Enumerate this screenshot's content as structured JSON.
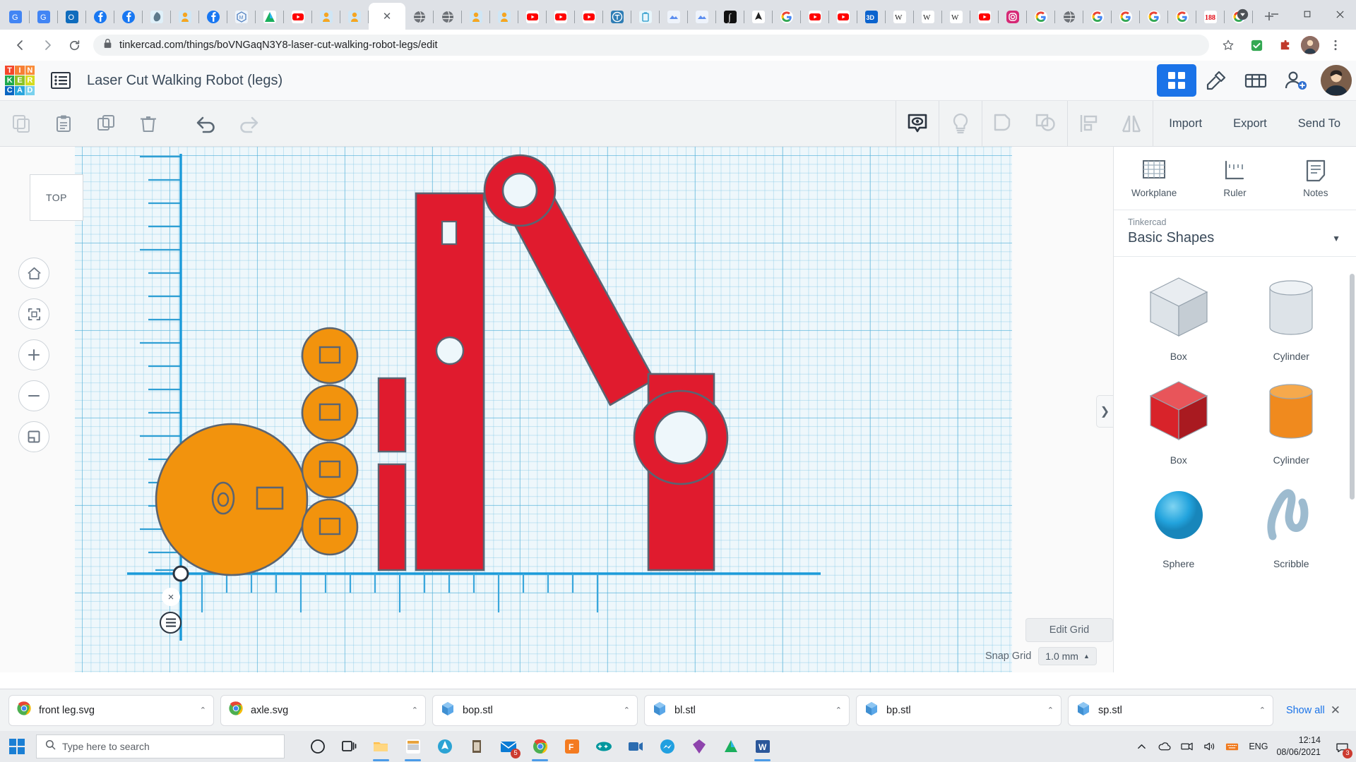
{
  "browser": {
    "url": "tinkercad.com/things/boVNGaqN3Y8-laser-cut-walking-robot-legs/edit",
    "lock_icon": "lock-icon",
    "back_icon": "back-arrow-icon",
    "forward_icon": "forward-arrow-icon",
    "reload_icon": "reload-icon",
    "star_icon": "bookmark-star-icon",
    "extension_icon": "extension-icon",
    "menu_icon": "chrome-menu-icon",
    "newtab_label": "+",
    "minimize_label": "—",
    "maximize_label": "❐",
    "close_label": "✕",
    "tabs": [
      {
        "name": "google-translate",
        "kind": "gtranslate",
        "active": false
      },
      {
        "name": "google-translate",
        "kind": "gtranslate",
        "active": false
      },
      {
        "name": "outlook",
        "kind": "outlook",
        "active": false
      },
      {
        "name": "facebook",
        "kind": "facebook",
        "active": false
      },
      {
        "name": "facebook",
        "kind": "facebook",
        "active": false
      },
      {
        "name": "tinkercad",
        "kind": "tinkercad-leaf",
        "active": false
      },
      {
        "name": "scratch",
        "kind": "scratch",
        "active": false
      },
      {
        "name": "facebook",
        "kind": "facebook",
        "active": false
      },
      {
        "name": "makers",
        "kind": "hexm",
        "active": false
      },
      {
        "name": "autodesk",
        "kind": "autodesk",
        "active": false
      },
      {
        "name": "youtube",
        "kind": "youtube",
        "active": false
      },
      {
        "name": "scratch",
        "kind": "scratch",
        "active": false
      },
      {
        "name": "scratch",
        "kind": "scratch",
        "active": false
      },
      {
        "name": "tinkercad-active",
        "kind": "active-tab",
        "active": true
      },
      {
        "name": "generic-page",
        "kind": "globe",
        "active": false
      },
      {
        "name": "generic-page",
        "kind": "globe",
        "active": false
      },
      {
        "name": "scratch",
        "kind": "scratch",
        "active": false
      },
      {
        "name": "scratch",
        "kind": "scratch",
        "active": false
      },
      {
        "name": "youtube",
        "kind": "youtube",
        "active": false
      },
      {
        "name": "youtube",
        "kind": "youtube",
        "active": false
      },
      {
        "name": "youtube",
        "kind": "youtube",
        "active": false
      },
      {
        "name": "thingiverse",
        "kind": "thingiverse",
        "active": false
      },
      {
        "name": "kidsdoc",
        "kind": "kidsdoc",
        "active": false
      },
      {
        "name": "slides",
        "kind": "slides",
        "active": false
      },
      {
        "name": "slides",
        "kind": "slides",
        "active": false
      },
      {
        "name": "integral",
        "kind": "integral",
        "active": false
      },
      {
        "name": "inkscape",
        "kind": "inkscape",
        "active": false
      },
      {
        "name": "google",
        "kind": "google",
        "active": false
      },
      {
        "name": "youtube",
        "kind": "youtube",
        "active": false
      },
      {
        "name": "youtube",
        "kind": "youtube",
        "active": false
      },
      {
        "name": "3d-viewer",
        "kind": "threed",
        "active": false
      },
      {
        "name": "wikipedia",
        "kind": "wikipedia",
        "active": false
      },
      {
        "name": "wikipedia",
        "kind": "wikipedia",
        "active": false
      },
      {
        "name": "wikipedia",
        "kind": "wikipedia",
        "active": false
      },
      {
        "name": "youtube",
        "kind": "youtube",
        "active": false
      },
      {
        "name": "instagram",
        "kind": "instagram",
        "active": false
      },
      {
        "name": "google",
        "kind": "google",
        "active": false
      },
      {
        "name": "generic-page",
        "kind": "globe",
        "active": false
      },
      {
        "name": "google",
        "kind": "google",
        "active": false
      },
      {
        "name": "google",
        "kind": "google",
        "active": false
      },
      {
        "name": "google",
        "kind": "google",
        "active": false
      },
      {
        "name": "google",
        "kind": "google",
        "active": false
      },
      {
        "name": "188",
        "kind": "one88",
        "active": false
      },
      {
        "name": "google",
        "kind": "google",
        "active": false
      }
    ]
  },
  "tinkercad": {
    "logo_letters": [
      "T",
      "I",
      "N",
      "K",
      "E",
      "R",
      "C",
      "A",
      "D"
    ],
    "logo_colors": [
      "#f4462a",
      "#f77f35",
      "#fa8c3a",
      "#1fa94e",
      "#8cc427",
      "#d5dc21",
      "#0a66c2",
      "#29a5dd",
      "#7ad2ee"
    ],
    "document_title": "Laser Cut Walking Robot (legs)",
    "hamburger_icon": "project-list-icon",
    "header_icons": [
      {
        "name": "blocks-view-icon",
        "selected": true
      },
      {
        "name": "codeblocks-icon",
        "selected": false
      },
      {
        "name": "gallery-icon",
        "selected": false
      },
      {
        "name": "add-user-icon",
        "selected": false
      }
    ],
    "avatar": "user-avatar"
  },
  "toolbar": {
    "left_tools": [
      {
        "name": "copy-icon",
        "label": "Copy"
      },
      {
        "name": "paste-icon",
        "label": "Paste"
      },
      {
        "name": "duplicate-icon",
        "label": "Duplicate"
      },
      {
        "name": "delete-icon",
        "label": "Delete"
      }
    ],
    "history_tools": [
      {
        "name": "undo-icon",
        "label": "Undo"
      },
      {
        "name": "redo-icon",
        "label": "Redo"
      }
    ],
    "right_tools": [
      {
        "name": "show-hide-icon",
        "label": "Show / Hide"
      },
      {
        "name": "light-icon",
        "label": "Light"
      },
      {
        "name": "group-icon",
        "label": "Group"
      },
      {
        "name": "ungroup-icon",
        "label": "Ungroup"
      },
      {
        "name": "align-icon",
        "label": "Align"
      },
      {
        "name": "mirror-icon",
        "label": "Mirror"
      }
    ],
    "import_label": "Import",
    "export_label": "Export",
    "send_to_label": "Send To"
  },
  "canvas": {
    "view_cube_label": "TOP",
    "nav_buttons": [
      {
        "name": "home-view-icon"
      },
      {
        "name": "fit-all-icon"
      },
      {
        "name": "zoom-in-icon"
      },
      {
        "name": "zoom-out-icon"
      },
      {
        "name": "orthographic-icon"
      }
    ],
    "ruler_close_label": "×",
    "ruler_menu_icon": "ruler-menu-icon",
    "edit_grid_label": "Edit Grid",
    "snap_grid_label": "Snap Grid",
    "snap_grid_value": "1.0 mm",
    "shapes": [
      {
        "name": "orange-disc-large",
        "color": "#f2930d"
      },
      {
        "name": "orange-disc-1",
        "color": "#f2930d"
      },
      {
        "name": "orange-disc-2",
        "color": "#f2930d"
      },
      {
        "name": "orange-disc-3",
        "color": "#f2930d"
      },
      {
        "name": "orange-disc-4",
        "color": "#f2930d"
      },
      {
        "name": "red-bar-small-top",
        "color": "#e01b2e"
      },
      {
        "name": "red-bar-small-bottom",
        "color": "#e01b2e"
      },
      {
        "name": "red-leg-main",
        "color": "#e01b2e"
      },
      {
        "name": "red-linkage-arm",
        "color": "#e01b2e"
      },
      {
        "name": "red-lower-leg",
        "color": "#e01b2e"
      }
    ]
  },
  "shapes_panel": {
    "tabs": [
      {
        "name": "workplane-tab",
        "label": "Workplane",
        "icon": "workplane-icon"
      },
      {
        "name": "ruler-tab",
        "label": "Ruler",
        "icon": "ruler-icon"
      },
      {
        "name": "notes-tab",
        "label": "Notes",
        "icon": "notes-icon"
      }
    ],
    "library_label": "Tinkercad",
    "library_value": "Basic Shapes",
    "caret": "▼",
    "handle_icon": "collapse-panel-icon",
    "items": [
      {
        "name": "shape-box-hatched",
        "label": "Box",
        "color": "#c9cfd6",
        "kind": "cube-hole"
      },
      {
        "name": "shape-cylinder-hatched",
        "label": "Cylinder",
        "color": "#c9cfd6",
        "kind": "cyl-hole"
      },
      {
        "name": "shape-box-red",
        "label": "Box",
        "color": "#d8232a",
        "kind": "cube"
      },
      {
        "name": "shape-cylinder-orange",
        "label": "Cylinder",
        "color": "#f08a1e",
        "kind": "cyl"
      },
      {
        "name": "shape-sphere-blue",
        "label": "Sphere",
        "color": "#22a3dd",
        "kind": "sphere"
      },
      {
        "name": "shape-scribble",
        "label": "Scribble",
        "color": "#97b4c9",
        "kind": "scribble"
      }
    ]
  },
  "downloads": {
    "items": [
      {
        "name": "download-front-leg-svg",
        "filename": "front leg.svg",
        "icon": "chrome-icon"
      },
      {
        "name": "download-axle-svg",
        "filename": "axle.svg",
        "icon": "chrome-icon"
      },
      {
        "name": "download-bop-stl",
        "filename": "bop.stl",
        "icon": "stl-icon"
      },
      {
        "name": "download-bl-stl",
        "filename": "bl.stl",
        "icon": "stl-icon"
      },
      {
        "name": "download-bp-stl",
        "filename": "bp.stl",
        "icon": "stl-icon"
      },
      {
        "name": "download-sp-stl",
        "filename": "sp.stl",
        "icon": "stl-icon"
      }
    ],
    "show_all_label": "Show all",
    "close_label": "✕",
    "caret": "^"
  },
  "taskbar": {
    "start_icon": "windows-start-icon",
    "search_placeholder": "Type here to search",
    "search_icon": "search-icon",
    "apps": [
      {
        "name": "cortana-icon",
        "running": false
      },
      {
        "name": "task-view-icon",
        "running": false
      },
      {
        "name": "file-explorer-icon",
        "running": true
      },
      {
        "name": "microsoft-store-icon",
        "running": true
      },
      {
        "name": "inkscape-icon",
        "running": false
      },
      {
        "name": "mousepad-icon",
        "running": false
      },
      {
        "name": "mail-icon",
        "running": false,
        "badge": "5"
      },
      {
        "name": "chrome-icon",
        "running": true
      },
      {
        "name": "fusion360-icon",
        "running": false
      },
      {
        "name": "arduino-icon",
        "running": false
      },
      {
        "name": "video-icon",
        "running": false
      },
      {
        "name": "messenger-icon",
        "running": false
      },
      {
        "name": "sketch-icon",
        "running": false
      },
      {
        "name": "autodesk-icon",
        "running": false
      },
      {
        "name": "word-icon",
        "running": true
      }
    ],
    "tray": [
      {
        "name": "show-hidden-icons",
        "glyph": "∧"
      },
      {
        "name": "onedrive-icon",
        "glyph": "☁"
      },
      {
        "name": "network-icon",
        "glyph": "▭"
      },
      {
        "name": "volume-icon",
        "glyph": "◁"
      },
      {
        "name": "keyboard-icon",
        "glyph": "⌨"
      }
    ],
    "language": "ENG",
    "time": "12:14",
    "date": "08/06/2021",
    "notification_icon": "action-center-icon",
    "notification_count": "3"
  }
}
